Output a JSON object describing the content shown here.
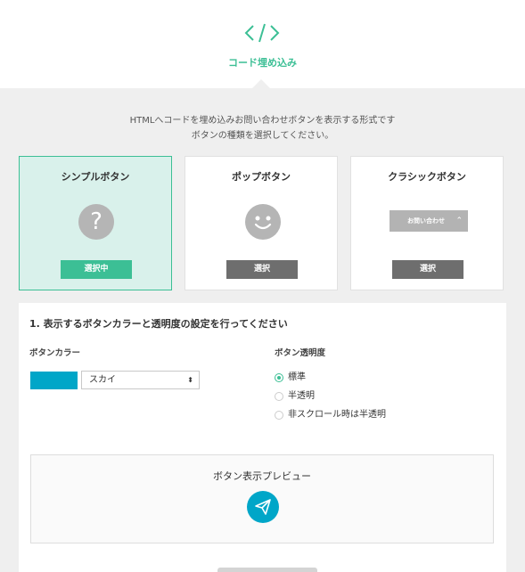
{
  "header": {
    "icon": "code-icon",
    "title": "コード埋め込み"
  },
  "intro": {
    "line1": "HTMLへコードを埋め込みお問い合わせボタンを表示する形式です",
    "line2": "ボタンの種類を選択してください。"
  },
  "cards": [
    {
      "title": "シンプルボタン",
      "icon": "question-icon",
      "icon_glyph": "?",
      "button": "選択中",
      "selected": true
    },
    {
      "title": "ポップボタン",
      "icon": "smiley-icon",
      "button": "選択",
      "selected": false
    },
    {
      "title": "クラシックボタン",
      "icon": "classic-button-preview",
      "pill_text": "お問い合わせ",
      "pill_caret": "⌃",
      "button": "選択",
      "selected": false
    }
  ],
  "settings": {
    "section_title": "1. 表示するボタンカラーと透明度の設定を行ってください",
    "color_label": "ボタンカラー",
    "color_swatch": "#00a6c8",
    "color_select_value": "スカイ",
    "color_select_arrow": "⬍",
    "opacity_label": "ボタン透明度",
    "opacity_options": [
      {
        "label": "標準",
        "checked": true
      },
      {
        "label": "半透明",
        "checked": false
      },
      {
        "label": "非スクロール時は半透明",
        "checked": false
      }
    ]
  },
  "preview": {
    "label": "ボタン表示プレビュー",
    "button_icon": "paper-plane-icon"
  },
  "colors": {
    "accent": "#3cbf95",
    "selected_bg": "#d9f1eb",
    "button_gray": "#6e6e6e",
    "sky": "#00a6c8"
  }
}
